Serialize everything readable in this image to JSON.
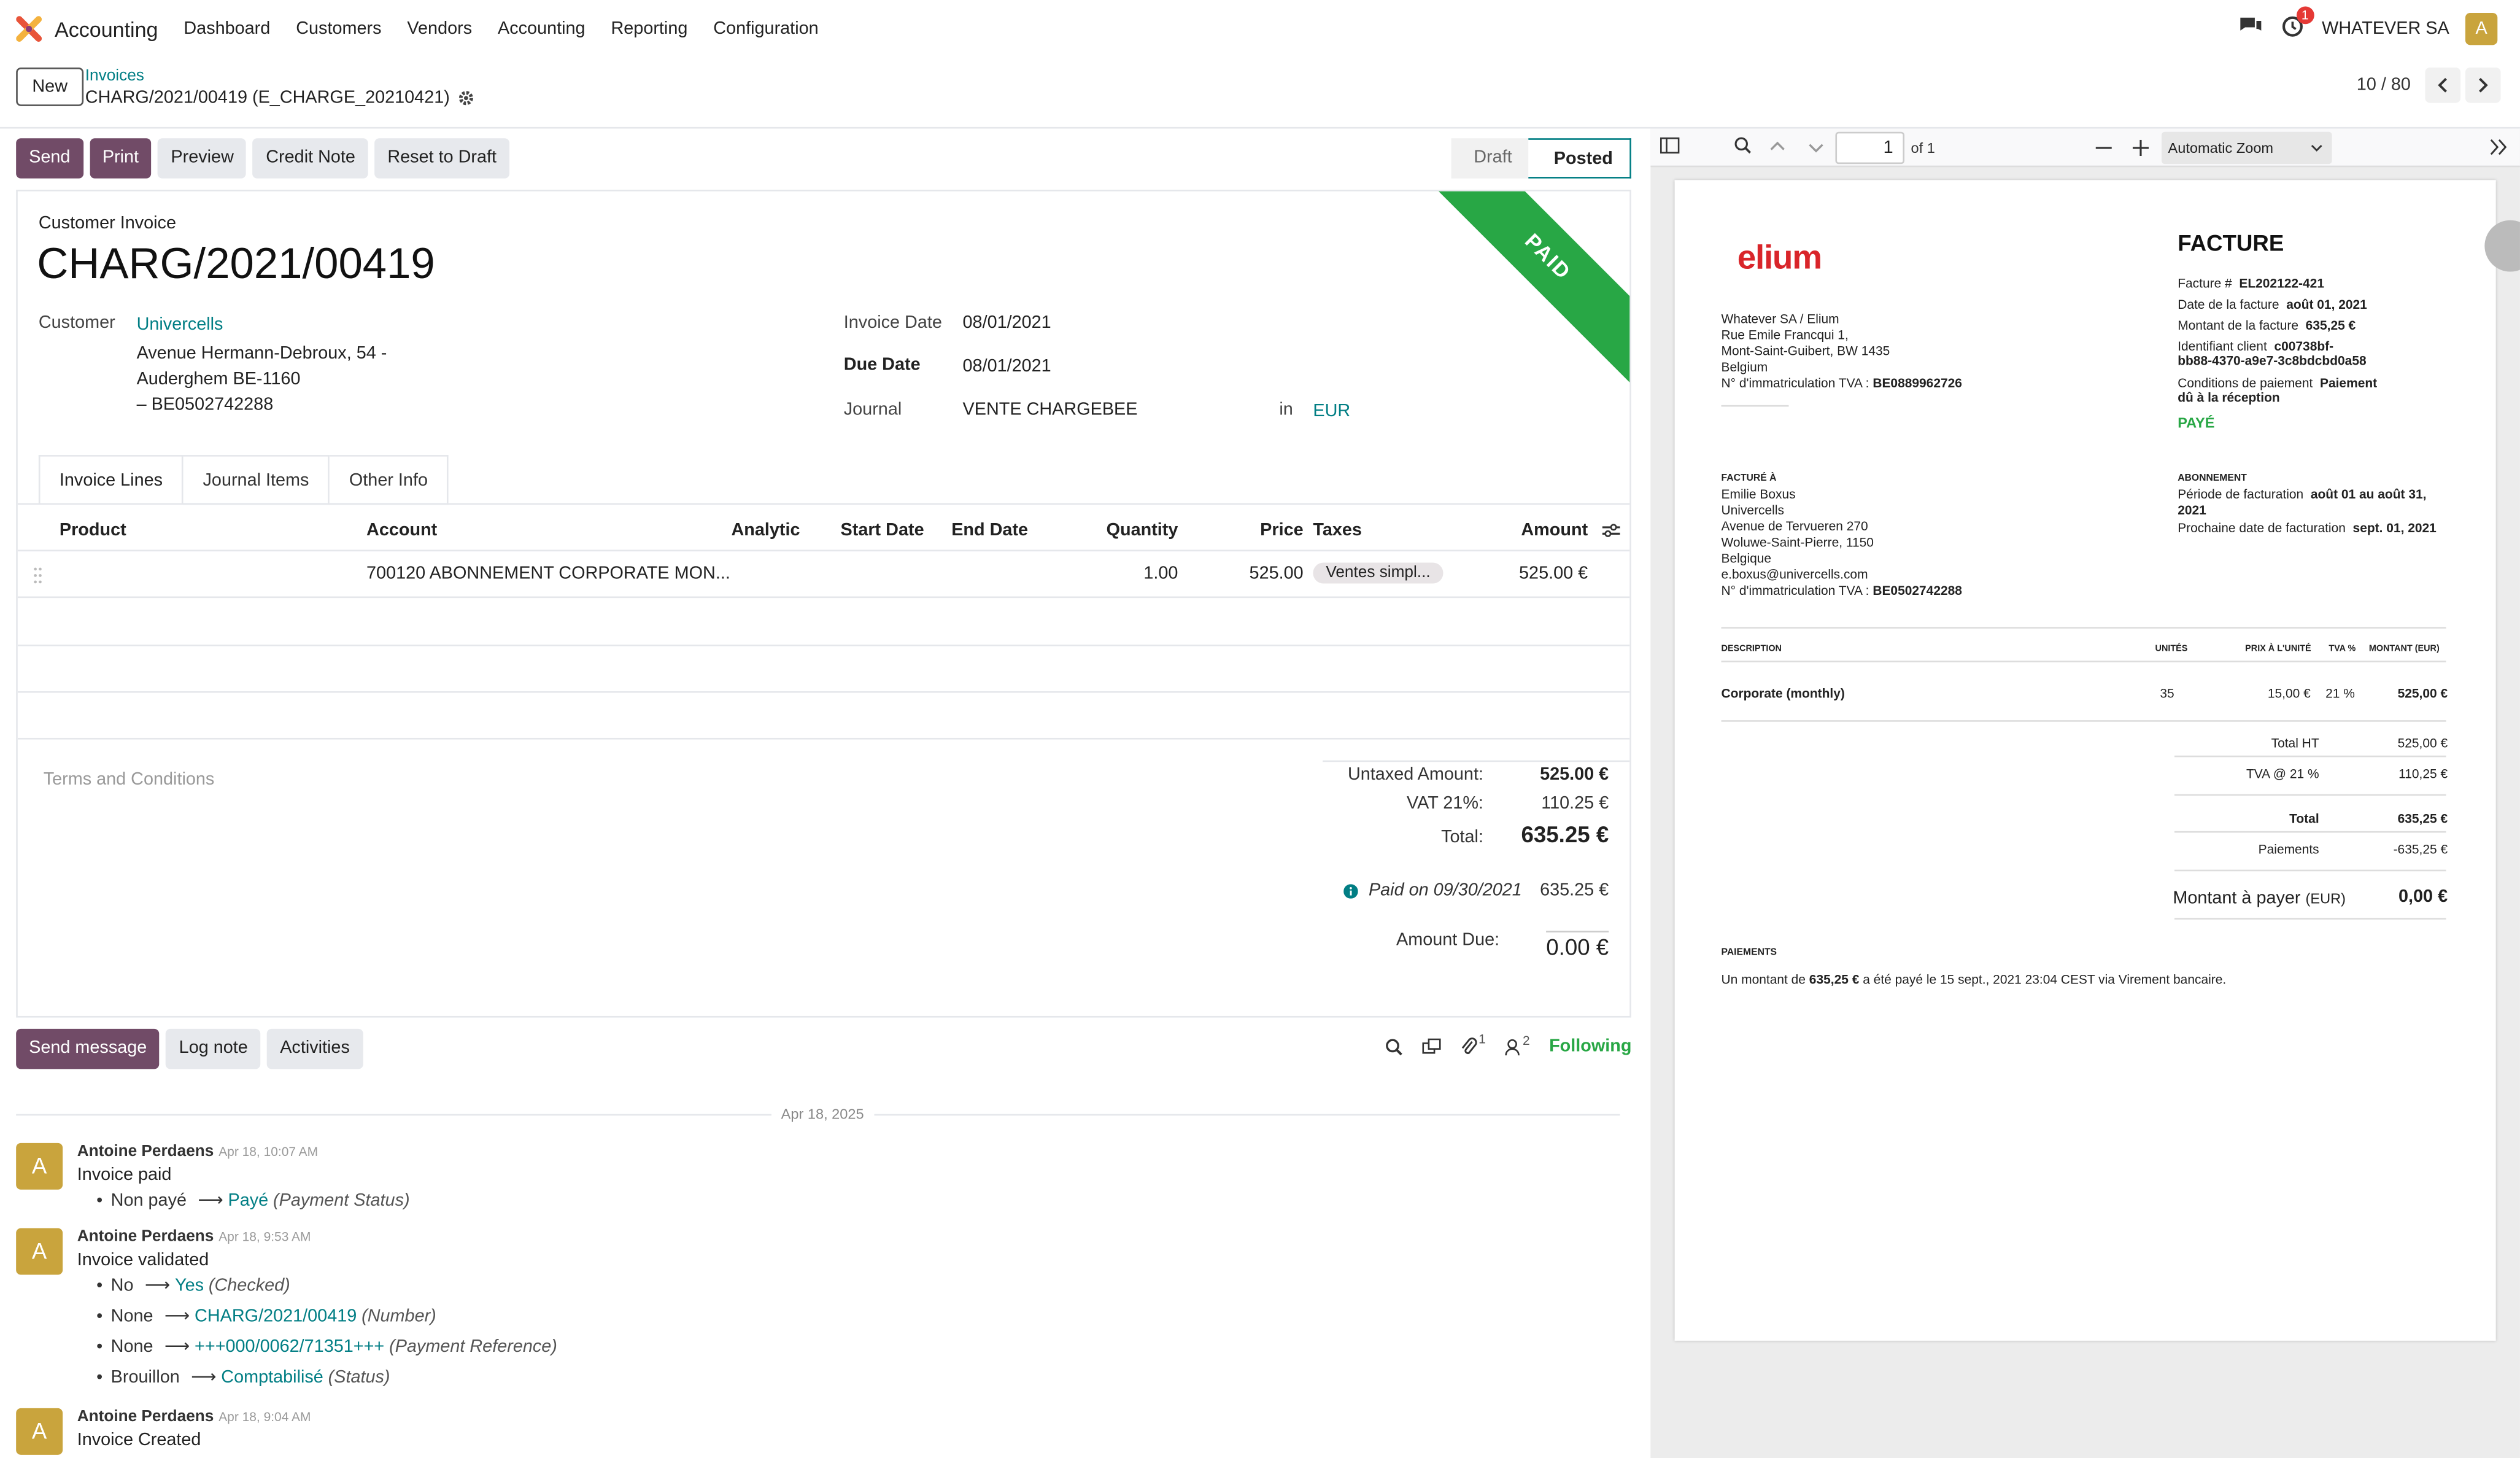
{
  "navbar": {
    "app_name": "Accounting",
    "menu": [
      "Dashboard",
      "Customers",
      "Vendors",
      "Accounting",
      "Reporting",
      "Configuration"
    ],
    "activity_badge": "1",
    "company": "WHATEVER SA",
    "avatar_letter": "A"
  },
  "control": {
    "new_label": "New",
    "breadcrumb_parent": "Invoices",
    "breadcrumb_current": "CHARG/2021/00419 (E_CHARGE_20210421)",
    "pager": "10 / 80"
  },
  "actions": {
    "send": "Send",
    "print": "Print",
    "preview": "Preview",
    "credit_note": "Credit Note",
    "reset_draft": "Reset to Draft"
  },
  "status": {
    "draft": "Draft",
    "posted": "Posted"
  },
  "invoice": {
    "ribbon": "PAID",
    "type": "Customer Invoice",
    "number": "CHARG/2021/00419",
    "customer_label": "Customer",
    "customer_name": "Univercells",
    "address_line1": "Avenue Hermann-Debroux, 54 -",
    "address_line2": "Auderghem BE-1160",
    "address_line3": "– BE0502742288",
    "invoice_date_label": "Invoice Date",
    "invoice_date": "08/01/2021",
    "due_date_label": "Due Date",
    "due_date": "08/01/2021",
    "journal_label": "Journal",
    "journal": "VENTE CHARGEBEE",
    "in_label": "in",
    "currency": "EUR"
  },
  "tabs": [
    "Invoice Lines",
    "Journal Items",
    "Other Info"
  ],
  "lines": {
    "headers": {
      "product": "Product",
      "account": "Account",
      "analytic": "Analytic",
      "start_date": "Start Date",
      "end_date": "End Date",
      "quantity": "Quantity",
      "price": "Price",
      "taxes": "Taxes",
      "amount": "Amount"
    },
    "rows": [
      {
        "product": "",
        "account": "700120 ABONNEMENT CORPORATE MON...",
        "analytic": "",
        "quantity": "1.00",
        "price": "525.00",
        "taxes": "Ventes simpl...",
        "amount": "525.00 €"
      }
    ]
  },
  "terms_placeholder": "Terms and Conditions",
  "totals": {
    "untaxed_label": "Untaxed Amount:",
    "untaxed": "525.00 €",
    "vat_label": "VAT 21%:",
    "vat": "110.25 €",
    "total_label": "Total:",
    "total": "635.25 €",
    "paid_label": "Paid on 09/30/2021",
    "paid": "635.25 €",
    "due_label": "Amount Due:",
    "due": "0.00 €"
  },
  "chatter": {
    "send_message": "Send message",
    "log_note": "Log note",
    "activities": "Activities",
    "attachments_count": "1",
    "followers_count": "2",
    "following": "Following",
    "date_separator": "Apr 18, 2025",
    "messages": [
      {
        "avatar": "A",
        "author": "Antoine Perdaens",
        "time": "Apr 18, 10:07 AM",
        "body": "Invoice paid",
        "changes": [
          {
            "old": "Non payé",
            "new": "Payé",
            "field": "(Payment Status)"
          }
        ]
      },
      {
        "avatar": "A",
        "author": "Antoine Perdaens",
        "time": "Apr 18, 9:53 AM",
        "body": "Invoice validated",
        "changes": [
          {
            "old": "No",
            "new": "Yes",
            "field": "(Checked)"
          },
          {
            "old": "None",
            "new": "CHARG/2021/00419",
            "field": "(Number)"
          },
          {
            "old": "None",
            "new": "+++000/0062/71351+++",
            "field": "(Payment Reference)"
          },
          {
            "old": "Brouillon",
            "new": "Comptabilisé",
            "field": "(Status)"
          }
        ]
      },
      {
        "avatar": "A",
        "author": "Antoine Perdaens",
        "time": "Apr 18, 9:04 AM",
        "body": "Invoice Created",
        "changes": []
      }
    ]
  },
  "pdf": {
    "page": "1",
    "of_pages": "of 1",
    "zoom": "Automatic Zoom",
    "logo": "elium",
    "title": "FACTURE",
    "sender": [
      "Whatever SA / Elium",
      "Rue Emile Francqui 1,",
      "Mont-Saint-Guibert, BW 1435",
      "Belgium"
    ],
    "sender_vat_label": "N° d'immatriculation TVA :",
    "sender_vat": "BE0889962726",
    "meta": [
      {
        "label": "Facture #",
        "value": "EL202122-421"
      },
      {
        "label": "Date de la facture",
        "value": "août 01, 2021"
      },
      {
        "label": "Montant de la facture",
        "value": "635,25 €"
      }
    ],
    "client_id_label": "Identifiant client",
    "client_id_1": "c00738bf-",
    "client_id_2": "bb88-4370-a9e7-3c8bdcbd0a58",
    "payment_terms_label": "Conditions de paiement",
    "payment_terms_1": "Paiement",
    "payment_terms_2": "dû à la réception",
    "paid_stamp": "PAYÉ",
    "billed_to_heading": "FACTURÉ À",
    "billed_to": [
      "Emilie Boxus",
      "Univercells",
      "Avenue de Tervueren 270",
      "Woluwe-Saint-Pierre, 1150",
      "Belgique",
      "e.boxus@univercells.com"
    ],
    "billed_vat_label": "N° d'immatriculation TVA :",
    "billed_vat": "BE0502742288",
    "subscription_heading": "ABONNEMENT",
    "period_label": "Période de facturation",
    "period_1": "août 01 au août 31,",
    "period_2": "2021",
    "next_billing_label": "Prochaine date de facturation",
    "next_billing": "sept. 01, 2021",
    "table_headers": {
      "description": "DESCRIPTION",
      "units": "UNITÉS",
      "unit_price": "PRIX À L'UNITÉ",
      "vat": "TVA %",
      "amount": "MONTANT (EUR)"
    },
    "line": {
      "description": "Corporate (monthly)",
      "units": "35",
      "unit_price": "15,00 €",
      "vat": "21 %",
      "amount": "525,00 €"
    },
    "total_ht_label": "Total HT",
    "total_ht": "525,00 €",
    "tva_label": "TVA @ 21 %",
    "tva": "110,25 €",
    "total_label": "Total",
    "total": "635,25 €",
    "payments_label": "Paiements",
    "payments": "-635,25 €",
    "to_pay_label": "Montant à payer",
    "to_pay_currency": "(EUR)",
    "to_pay": "0,00 €",
    "payments_heading": "PAIEMENTS",
    "payment_note_1": "Un montant de",
    "payment_note_amount": "635,25 €",
    "payment_note_2": "a été payé le 15 sept., 2021 23:04 CEST via Virement bancaire."
  },
  "colors": {
    "primary": "#714b67",
    "link": "#017e84",
    "paid": "#28a745",
    "avatar": "#c9a43d",
    "brand_red": "#d9252a"
  }
}
